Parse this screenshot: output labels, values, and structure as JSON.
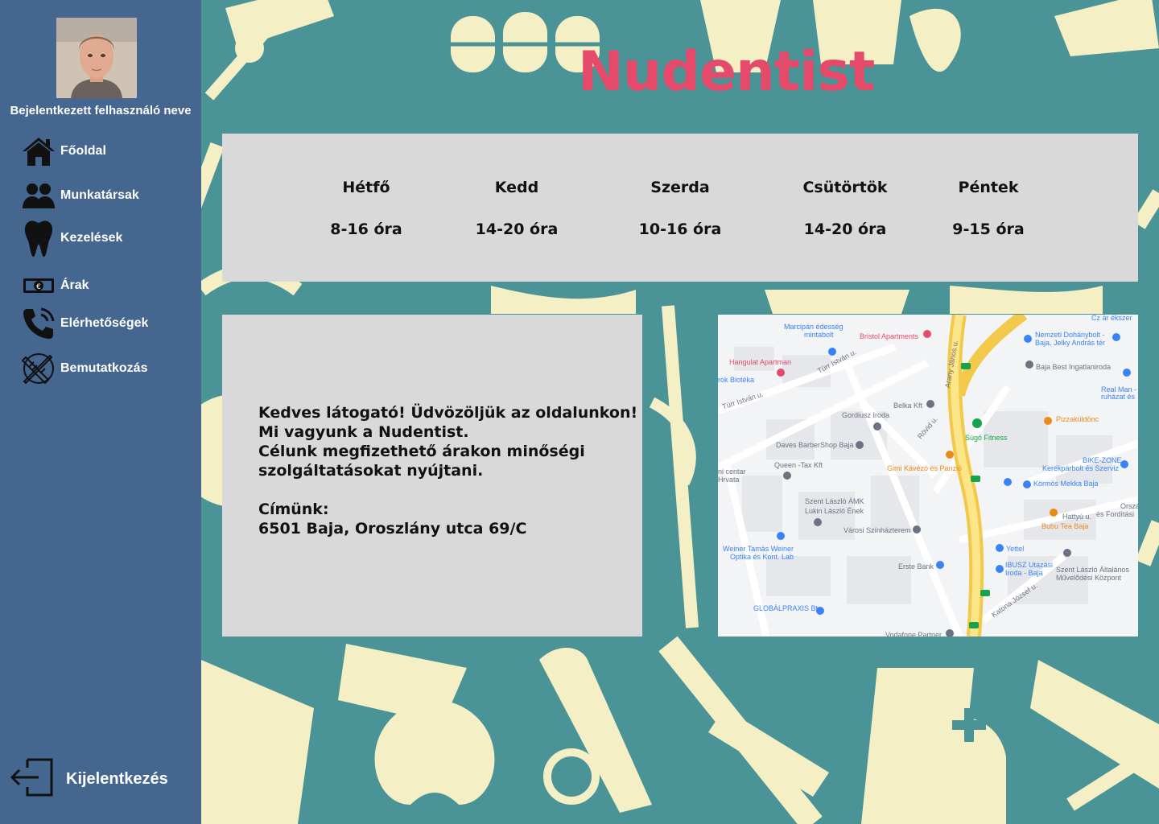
{
  "sidebar": {
    "user_name": "Bejelentkezett felhasználó neve",
    "nav": [
      {
        "label": "Főoldal",
        "icon": "home-icon"
      },
      {
        "label": "Munkatársak",
        "icon": "people-icon"
      },
      {
        "label": "Kezelések",
        "icon": "tooth-icon"
      },
      {
        "label": "Árak",
        "icon": "money-icon"
      },
      {
        "label": "Elérhetőségek",
        "icon": "phone-icon"
      },
      {
        "label": "Bemutatkozás",
        "icon": "tools-icon"
      }
    ],
    "logout_label": "Kijelentkezés"
  },
  "header": {
    "title": "Nudentist"
  },
  "hours": [
    {
      "day": "Hétfő",
      "time": "8-16 óra"
    },
    {
      "day": "Kedd",
      "time": "14-20 óra"
    },
    {
      "day": "Szerda",
      "time": "10-16 óra"
    },
    {
      "day": "Csütörtök",
      "time": "14-20 óra"
    },
    {
      "day": "Péntek",
      "time": "9-15 óra"
    }
  ],
  "info": {
    "text": "Kedves látogató! Üdvözöljük az oldalunkon!\nMi vagyunk a Nudentist.\nCélunk megfizethető árakon minőségi\nszolgáltatásokat nyújtani.\n\nCímünk:\n6501 Baja, Oroszlány utca 69/C"
  },
  "map": {
    "labels": [
      {
        "text": "Marcipán édesség",
        "cls": "blue"
      },
      {
        "text": "mintabolt",
        "cls": "blue"
      },
      {
        "text": "Bristol Apartments",
        "cls": "pink"
      },
      {
        "text": "Hangulat Apartman",
        "cls": "pink"
      },
      {
        "text": "rok Biotéka",
        "cls": "blue"
      },
      {
        "text": "Türr István u.",
        "cls": ""
      },
      {
        "text": "Türr István u.",
        "cls": ""
      },
      {
        "text": "Arany János u.",
        "cls": ""
      },
      {
        "text": "Belka Kft",
        "cls": ""
      },
      {
        "text": "Gordiusz Iroda",
        "cls": ""
      },
      {
        "text": "Daves BarberShop Baja",
        "cls": ""
      },
      {
        "text": "Queen -Tax Kft",
        "cls": ""
      },
      {
        "text": "ni centar",
        "cls": ""
      },
      {
        "text": "Hrvata",
        "cls": ""
      },
      {
        "text": "Szent László ÁMK",
        "cls": ""
      },
      {
        "text": "Lukin László Ének",
        "cls": ""
      },
      {
        "text": "Városi Színházterem",
        "cls": ""
      },
      {
        "text": "Weiner Tamás Weiner",
        "cls": "blue"
      },
      {
        "text": "Optika és Kont. Lab",
        "cls": "blue"
      },
      {
        "text": "Erste Bank",
        "cls": ""
      },
      {
        "text": "GLOBÁLPRAXIS Bt",
        "cls": "blue"
      },
      {
        "text": "Gimi Kávézó és Panzió",
        "cls": "orange"
      },
      {
        "text": "Súgó Fitness",
        "cls": "green"
      },
      {
        "text": "Pizzaküldönc",
        "cls": "orange"
      },
      {
        "text": "Nemzeti Dohánybolt -",
        "cls": "blue"
      },
      {
        "text": "Baja, Jelky András tér",
        "cls": "blue"
      },
      {
        "text": "Baja Best Ingatlaniroda",
        "cls": ""
      },
      {
        "text": "Real Man -",
        "cls": "blue"
      },
      {
        "text": "ruházat és",
        "cls": "blue"
      },
      {
        "text": "BIKE-ZONE",
        "cls": "blue"
      },
      {
        "text": "Kerékpárbolt és Szerviz",
        "cls": "blue"
      },
      {
        "text": "Körmös Mekka Baja",
        "cls": "blue"
      },
      {
        "text": "Hattyú u.",
        "cls": ""
      },
      {
        "text": "Bubu Tea Baja",
        "cls": "orange"
      },
      {
        "text": "Yettel",
        "cls": "blue"
      },
      {
        "text": "IBUSZ Utazási",
        "cls": "blue"
      },
      {
        "text": "Iroda - Baja",
        "cls": "blue"
      },
      {
        "text": "Szent László Általános",
        "cls": ""
      },
      {
        "text": "Művelődési Központ",
        "cls": ""
      },
      {
        "text": "Katona József u.",
        "cls": ""
      },
      {
        "text": "Cz ár ékszer",
        "cls": "blue"
      },
      {
        "text": "Ország",
        "cls": ""
      },
      {
        "text": "és Fordítási",
        "cls": ""
      },
      {
        "text": "Rövid u.",
        "cls": ""
      },
      {
        "text": "Vodafone Partner",
        "cls": ""
      }
    ]
  },
  "colors": {
    "sidebar": "#45668f",
    "background": "#4a9397",
    "pattern": "#f4efc4",
    "title": "#e54a6a",
    "panel": "#d9d9d9"
  }
}
